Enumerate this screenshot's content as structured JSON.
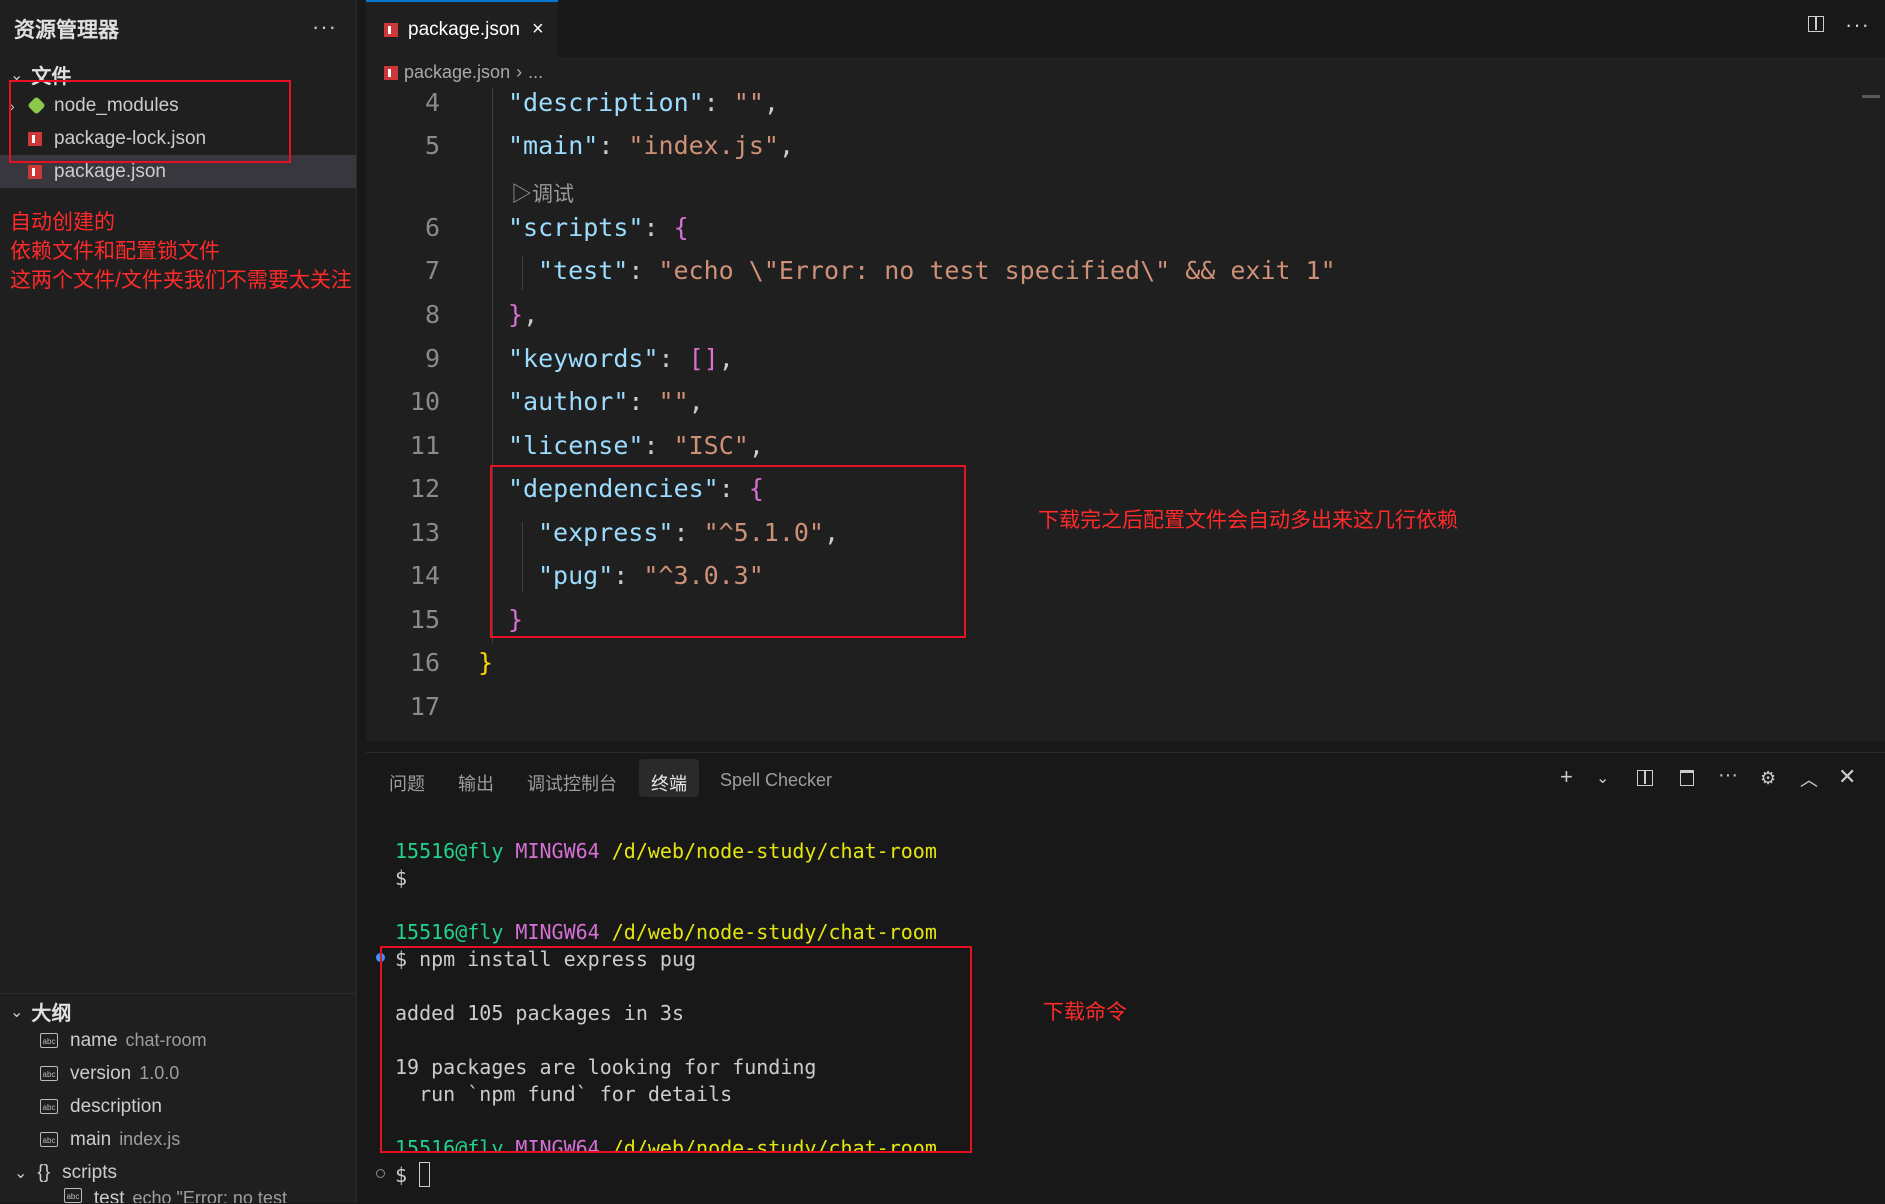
{
  "sidebar": {
    "title": "资源管理器",
    "more": "···",
    "files_section": "文件",
    "files": [
      {
        "name": "node_modules",
        "icon": "node-folder-icon"
      },
      {
        "name": "package-lock.json",
        "icon": "npm-icon"
      },
      {
        "name": "package.json",
        "icon": "npm-icon"
      }
    ],
    "note_lines": [
      "自动创建的",
      "依赖文件和配置锁文件",
      "这两个文件/文件夹我们不需要太关注"
    ],
    "outline_section": "大纲",
    "outline": [
      {
        "key": "name",
        "value": "chat-room"
      },
      {
        "key": "version",
        "value": "1.0.0"
      },
      {
        "key": "description",
        "value": ""
      },
      {
        "key": "main",
        "value": "index.js"
      },
      {
        "key": "scripts",
        "value": ""
      },
      {
        "key": "test",
        "value": "echo \"Error: no test specifi..."
      }
    ]
  },
  "editor": {
    "tab_label": "package.json",
    "tab_close": "×",
    "breadcrumb_file": "package.json",
    "breadcrumb_more": "...",
    "codelens": "▷调试",
    "line_numbers": [
      "4",
      "5",
      "6",
      "7",
      "8",
      "9",
      "10",
      "11",
      "12",
      "13",
      "14",
      "15",
      "16",
      "17"
    ],
    "code": {
      "description_key": "\"description\"",
      "description_val": "\"\"",
      "main_key": "\"main\"",
      "main_val": "\"index.js\"",
      "scripts_key": "\"scripts\"",
      "test_key": "\"test\"",
      "test_val": "\"echo \\\"Error: no test specified\\\" && exit 1\"",
      "keywords_key": "\"keywords\"",
      "author_key": "\"author\"",
      "author_val": "\"\"",
      "license_key": "\"license\"",
      "license_val": "\"ISC\"",
      "dependencies_key": "\"dependencies\"",
      "express_key": "\"express\"",
      "express_val": "\"^5.1.0\"",
      "pug_key": "\"pug\"",
      "pug_val": "\"^3.0.3\""
    },
    "note": "下载完之后配置文件会自动多出来这几行依赖"
  },
  "panel": {
    "tabs": [
      "问题",
      "输出",
      "调试控制台",
      "终端",
      "Spell Checker"
    ],
    "active_tab": "终端",
    "terminal": {
      "user": "15516@fly",
      "system": "MINGW64",
      "path": "/d/web/node-study/chat-room",
      "prompt": "$",
      "command": "$ npm install express pug",
      "added": "added 105 packages in 3s",
      "funding1": "19 packages are looking for funding",
      "funding2": "  run `npm fund` for details"
    },
    "note": "下载命令"
  },
  "colors": {
    "accent": "#0078d4",
    "annotation_red": "#e81123"
  }
}
